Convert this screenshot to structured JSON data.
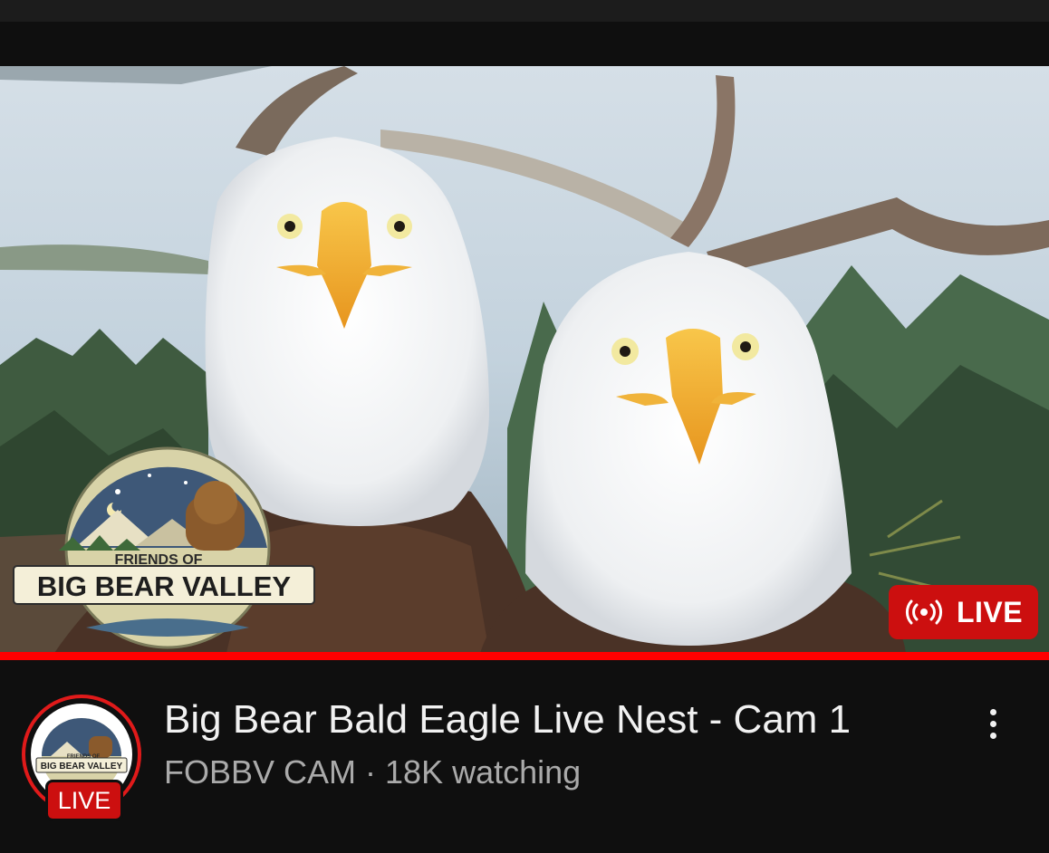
{
  "video": {
    "live_badge": "LIVE",
    "logo": {
      "line1": "FRIENDS OF",
      "line2": "BIG BEAR VALLEY"
    }
  },
  "channel": {
    "avatar_live": "LIVE",
    "avatar_logo_line1": "FRIENDS OF",
    "avatar_logo_line2": "BIG BEAR VALLEY"
  },
  "title": "Big Bear Bald Eagle Live Nest - Cam 1",
  "subtitle": "FOBBV CAM · 18K watching",
  "colors": {
    "live_red": "#cc0f0f",
    "progress_red": "#ff0000",
    "background": "#0f0f0f",
    "title_text": "#f1f1f1",
    "subtitle_text": "#aaaaaa"
  },
  "icons": [
    "broadcast-icon",
    "more-vert-icon"
  ]
}
